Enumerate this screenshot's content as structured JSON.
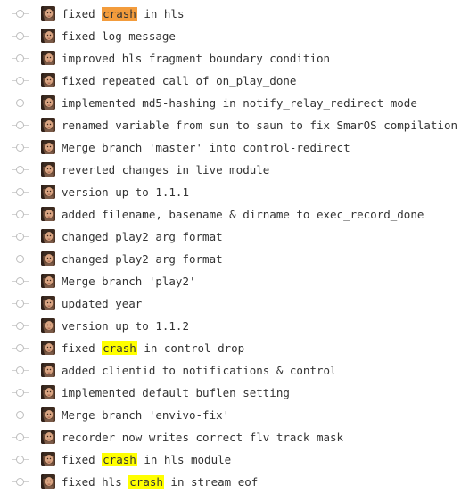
{
  "colors": {
    "highlight_current": "#f39c3c",
    "highlight_match": "#ffff00",
    "text": "#333333",
    "graph_line": "#d3d3d3"
  },
  "icons": {
    "commit_node": "commit-dot-icon",
    "avatar": "author-avatar"
  },
  "commits": [
    {
      "parts": [
        {
          "text": "fixed "
        },
        {
          "text": "crash",
          "hl": "current"
        },
        {
          "text": " in hls"
        }
      ]
    },
    {
      "parts": [
        {
          "text": "fixed log message"
        }
      ]
    },
    {
      "parts": [
        {
          "text": "improved hls fragment boundary condition"
        }
      ]
    },
    {
      "parts": [
        {
          "text": "fixed repeated call of on_play_done"
        }
      ]
    },
    {
      "parts": [
        {
          "text": "implemented md5-hashing in notify_relay_redirect mode"
        }
      ]
    },
    {
      "parts": [
        {
          "text": "renamed variable from sun to saun to fix SmarOS compilation"
        }
      ]
    },
    {
      "parts": [
        {
          "text": "Merge branch 'master' into control-redirect"
        }
      ]
    },
    {
      "parts": [
        {
          "text": "reverted changes in live module"
        }
      ]
    },
    {
      "parts": [
        {
          "text": "version up to 1.1.1"
        }
      ]
    },
    {
      "parts": [
        {
          "text": "added filename, basename & dirname to exec_record_done"
        }
      ]
    },
    {
      "parts": [
        {
          "text": "changed play2 arg format"
        }
      ]
    },
    {
      "parts": [
        {
          "text": "changed play2 arg format"
        }
      ]
    },
    {
      "parts": [
        {
          "text": "Merge branch 'play2'"
        }
      ]
    },
    {
      "parts": [
        {
          "text": "updated year"
        }
      ]
    },
    {
      "parts": [
        {
          "text": "version up to 1.1.2"
        }
      ]
    },
    {
      "parts": [
        {
          "text": "fixed "
        },
        {
          "text": "crash",
          "hl": "match"
        },
        {
          "text": " in control drop"
        }
      ]
    },
    {
      "parts": [
        {
          "text": "added clientid to notifications & control"
        }
      ]
    },
    {
      "parts": [
        {
          "text": "implemented default buflen setting"
        }
      ]
    },
    {
      "parts": [
        {
          "text": "Merge branch 'envivo-fix'"
        }
      ]
    },
    {
      "parts": [
        {
          "text": "recorder now writes correct flv track mask"
        }
      ]
    },
    {
      "parts": [
        {
          "text": "fixed "
        },
        {
          "text": "crash",
          "hl": "match"
        },
        {
          "text": " in hls module"
        }
      ]
    },
    {
      "parts": [
        {
          "text": "fixed hls "
        },
        {
          "text": "crash",
          "hl": "match"
        },
        {
          "text": " in stream eof"
        }
      ]
    }
  ]
}
